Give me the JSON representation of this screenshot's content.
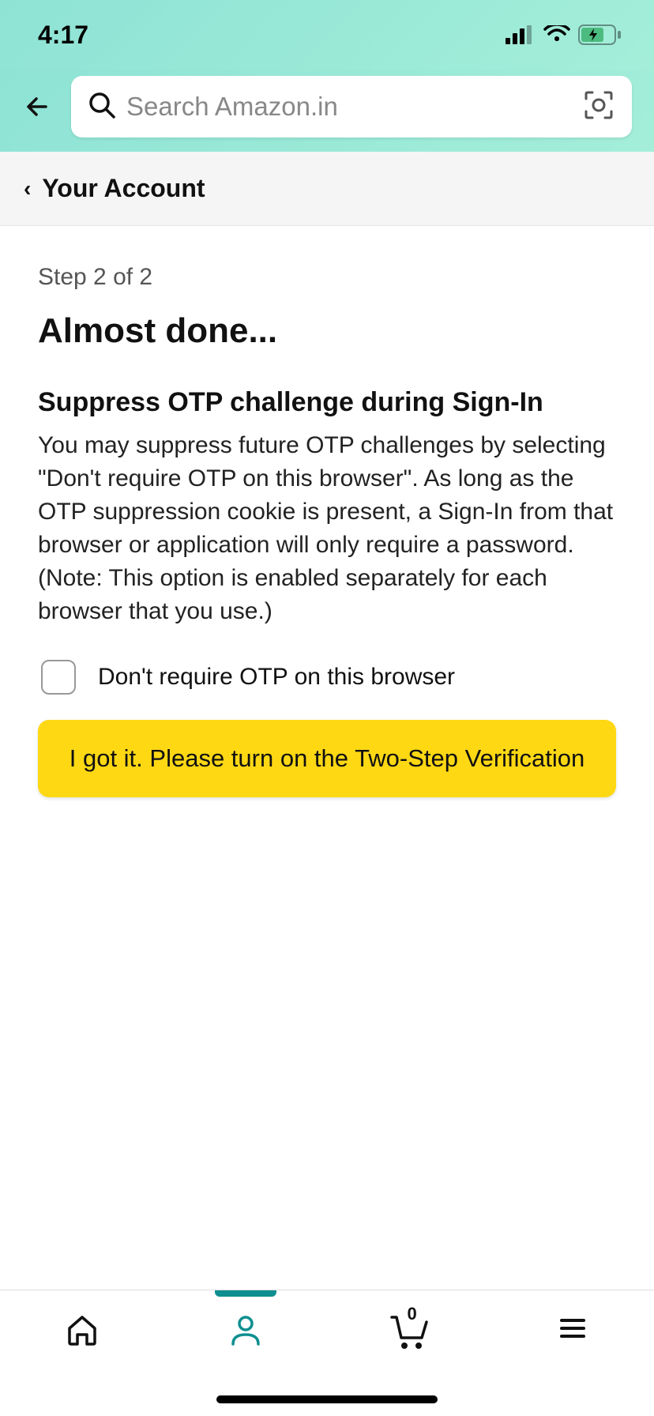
{
  "status": {
    "time": "4:17"
  },
  "search": {
    "placeholder": "Search Amazon.in"
  },
  "breadcrumb": {
    "label": "Your Account"
  },
  "content": {
    "step": "Step 2 of 2",
    "title": "Almost done...",
    "subtitle": "Suppress OTP challenge during Sign-In",
    "description": "You may suppress future OTP challenges by selecting \"Don't require OTP on this browser\". As long as the OTP suppression cookie is present, a Sign-In from that browser or application will only require a password. (Note: This option is enabled separately for each browser that you use.)",
    "checkbox_label": "Don't require OTP on this browser",
    "button_label": "I got it. Please turn on the Two-Step Verification"
  },
  "bottomnav": {
    "cart_count": "0"
  }
}
